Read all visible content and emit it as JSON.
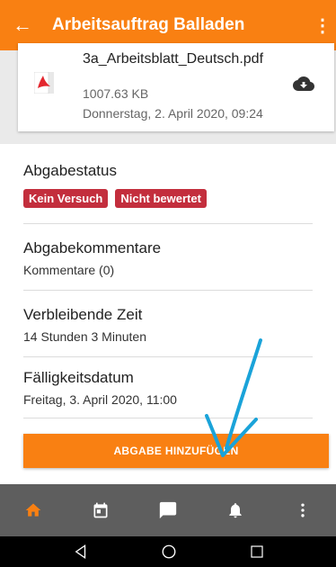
{
  "header": {
    "back_icon": "arrow-back-icon",
    "title": "Arbeitsauftrag Balladen",
    "more_icon": "more-vert-icon"
  },
  "file": {
    "icon": "pdf-file-icon",
    "name": "3a_Arbeitsblatt_Deutsch.pdf",
    "size": "1007.63 KB",
    "date": "Donnerstag, 2. April 2020, 09:24",
    "download_icon": "cloud-download-icon"
  },
  "status": {
    "label": "Abgabestatus",
    "badges": [
      "Kein Versuch",
      "Nicht bewertet"
    ],
    "badge_color": "#c32e3d"
  },
  "comments": {
    "label": "Abgabekommentare",
    "value": "Kommentare (0)"
  },
  "remaining": {
    "label": "Verbleibende Zeit",
    "value": "14 Stunden 3 Minuten"
  },
  "due": {
    "label": "Fälligkeitsdatum",
    "value": "Freitag, 3. April 2020, 11:00"
  },
  "submit_button": "ABGABE HINZUFÜGEN",
  "colors": {
    "accent": "#f98012",
    "tabbar": "#5e5e5e",
    "annotation_arrow": "#1aa3d9"
  },
  "tabbar": [
    "home-icon",
    "calendar-icon",
    "messages-icon",
    "notifications-icon",
    "more-vert-icon"
  ],
  "navbar": [
    "back-triangle-icon",
    "home-circle-icon",
    "recents-square-icon"
  ]
}
